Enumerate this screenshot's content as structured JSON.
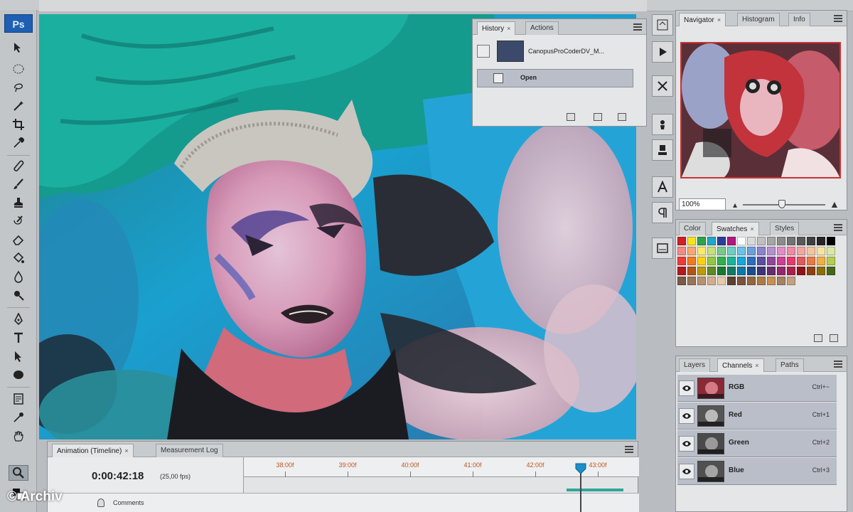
{
  "app": {
    "logo": "Ps"
  },
  "history_panel": {
    "tabs": [
      {
        "label": "History",
        "active": true
      },
      {
        "label": "Actions",
        "active": false
      }
    ],
    "snapshot_label": "CanopusProCoderDV_M...",
    "steps": [
      {
        "label": "Open",
        "selected": true
      }
    ]
  },
  "navigator_panel": {
    "tabs": [
      {
        "label": "Navigator",
        "active": true
      },
      {
        "label": "Histogram",
        "active": false
      },
      {
        "label": "Info",
        "active": false
      }
    ],
    "zoom": "100%",
    "view_box_color": "#cc3333"
  },
  "swatches_panel": {
    "tabs": [
      {
        "label": "Color",
        "active": false
      },
      {
        "label": "Swatches",
        "active": true
      },
      {
        "label": "Styles",
        "active": false
      }
    ],
    "colors": [
      "#d11f23",
      "#f2e51b",
      "#2ea34a",
      "#22a6c7",
      "#2d3e99",
      "#b0197e",
      "#ffffff",
      "#d9d9d9",
      "#bfbfbf",
      "#a6a6a6",
      "#8c8c8c",
      "#737373",
      "#595959",
      "#404040",
      "#262626",
      "#000000",
      "#f28b82",
      "#f7a86e",
      "#fbe96b",
      "#c6e07a",
      "#79c98b",
      "#6ccfc4",
      "#6bc2e6",
      "#6e9fdc",
      "#8e82cf",
      "#b68fcf",
      "#e28cc6",
      "#f08aa5",
      "#f3a6a0",
      "#f5c59e",
      "#f7e4a2",
      "#d9e8a4",
      "#ee3b35",
      "#f47a20",
      "#fcd20f",
      "#93c83e",
      "#2eb24a",
      "#18b59b",
      "#17a6dd",
      "#2c6fbe",
      "#5c4ea3",
      "#92479b",
      "#cf3f93",
      "#e9396c",
      "#e2595a",
      "#e97a43",
      "#f0b040",
      "#b4cd4e",
      "#b4191d",
      "#b45516",
      "#bf9a0d",
      "#5f8a26",
      "#19792e",
      "#117a69",
      "#0c7aa6",
      "#1d4d8c",
      "#3f3477",
      "#672e6f",
      "#95286a",
      "#ab2149",
      "#8f1317",
      "#8f420f",
      "#8a6f08",
      "#466619",
      "#7a5b45",
      "#9b7558",
      "#b79272",
      "#d1ae8e",
      "#e6caa9",
      "#5d4030",
      "#7a553b",
      "#94673f",
      "#ad7b47",
      "#c69055",
      "#a68162",
      "#c3a180"
    ]
  },
  "channels_panel": {
    "tabs": [
      {
        "label": "Layers",
        "active": false
      },
      {
        "label": "Channels",
        "active": true
      },
      {
        "label": "Paths",
        "active": false
      }
    ],
    "channels": [
      {
        "name": "RGB",
        "shortcut": "Ctrl+~"
      },
      {
        "name": "Red",
        "shortcut": "Ctrl+1"
      },
      {
        "name": "Green",
        "shortcut": "Ctrl+2"
      },
      {
        "name": "Blue",
        "shortcut": "Ctrl+3"
      }
    ]
  },
  "timeline": {
    "tabs": [
      {
        "label": "Animation (Timeline)",
        "active": true
      },
      {
        "label": "Measurement Log",
        "active": false
      }
    ],
    "timecode": "0:00:42:18",
    "fps": "(25,00 fps)",
    "ruler_labels": [
      "38:00f",
      "39:00f",
      "40:00f",
      "41:00f",
      "42:00f",
      "43:00f"
    ],
    "playhead_time": "42:18",
    "track_label": "Comments"
  },
  "watermark": "© Archiv"
}
